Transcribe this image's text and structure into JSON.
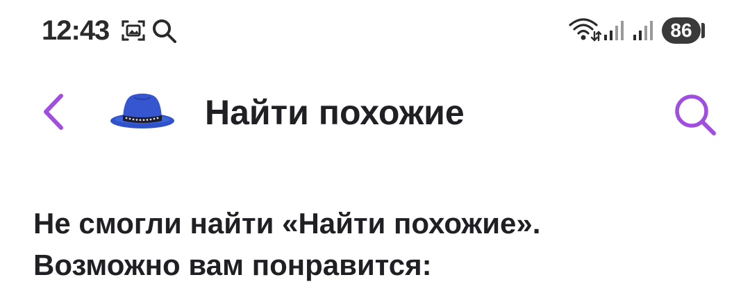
{
  "status_bar": {
    "time": "12:43",
    "battery": "86",
    "icons": [
      "screenshot-icon",
      "search-icon",
      "wifi-icon",
      "signal-icon",
      "signal-icon"
    ]
  },
  "header": {
    "title": "Найти похожие",
    "back_icon": "chevron-left-icon",
    "image_icon": "hat-icon",
    "search_icon": "search-icon"
  },
  "message": {
    "line1": "Не смогли найти «Найти похожие».",
    "line2": "Возможно вам понравится:"
  },
  "colors": {
    "accent": "#a04ee0",
    "text": "#1f1f24",
    "hat": "#2f52c8",
    "status_text": "#2a2a2a"
  }
}
